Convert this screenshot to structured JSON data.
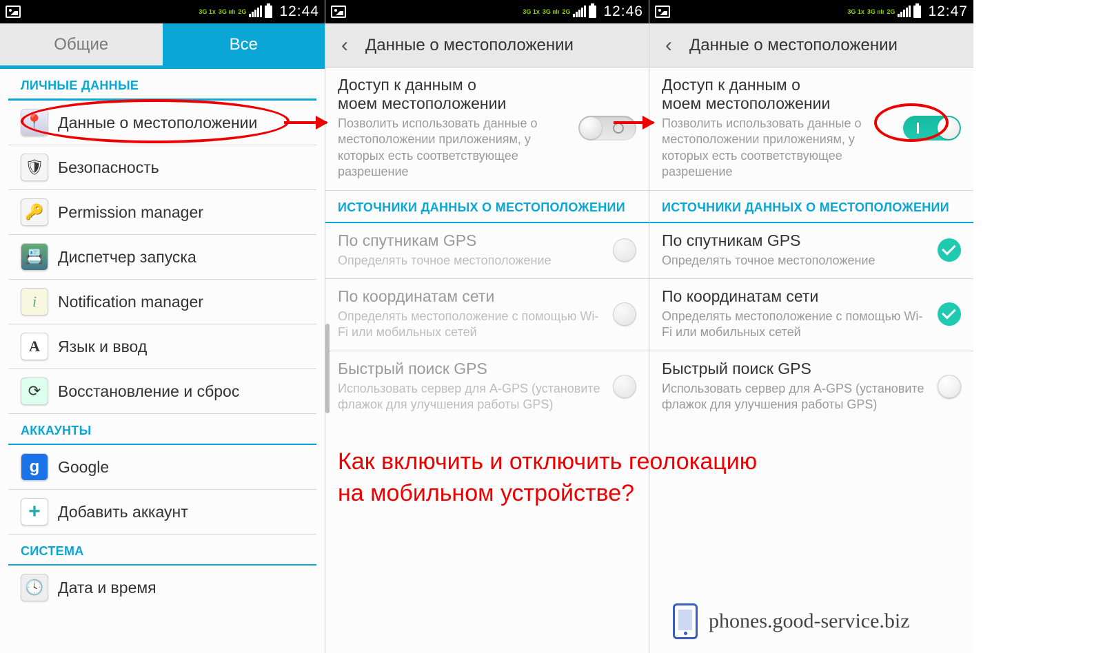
{
  "status": {
    "net1": "3G 1x",
    "net2": "3G ıılı",
    "net3": "2G",
    "time1": "12:44",
    "time2": "12:46",
    "time3": "12:47"
  },
  "pane1": {
    "tabs": {
      "general": "Общие",
      "all": "Все"
    },
    "sections": {
      "personal": "ЛИЧНЫЕ ДАННЫЕ",
      "accounts": "АККАУНТЫ",
      "system": "СИСТЕМА"
    },
    "items": {
      "location": "Данные о местоположении",
      "security": "Безопасность",
      "permission": "Permission manager",
      "dispatcher": "Диспетчер запуска",
      "notification": "Notification manager",
      "lang": "Язык и ввод",
      "reset": "Восстановление и сброс",
      "google": "Google",
      "addacct": "Добавить аккаунт",
      "datetime": "Дата и время"
    },
    "icons": {
      "location": "📍",
      "security": "🛡",
      "permission": "🔑",
      "dispatcher": "📇",
      "notification": "i",
      "lang": "A",
      "reset": "⟳",
      "google": "g",
      "addacct": "+",
      "datetime": "🕓"
    }
  },
  "detail": {
    "header": "Данные о местоположении",
    "access": {
      "title_l1": "Доступ к данным о",
      "title_l2": "моем местоположении",
      "sub": "Позволить использовать данные о местоположении приложениям, у которых есть соответствующее разрешение"
    },
    "sources_header": "ИСТОЧНИКИ ДАННЫХ О МЕСТОПОЛОЖЕНИИ",
    "gps": {
      "title": "По спутникам GPS",
      "sub": "Определять точное местоположение"
    },
    "net": {
      "title": "По координатам сети",
      "sub": "Определять местоположение с помощью Wi-Fi или мобильных сетей"
    },
    "agps": {
      "title": "Быстрый поиск GPS",
      "sub": "Использовать сервер для A-GPS (установите флажок для улучшения работы GPS)"
    }
  },
  "annotation": {
    "caption_l1": "Как включить и отключить геолокацию",
    "caption_l2": "на мобильном устройстве?",
    "site": "phones.good-service.biz"
  }
}
